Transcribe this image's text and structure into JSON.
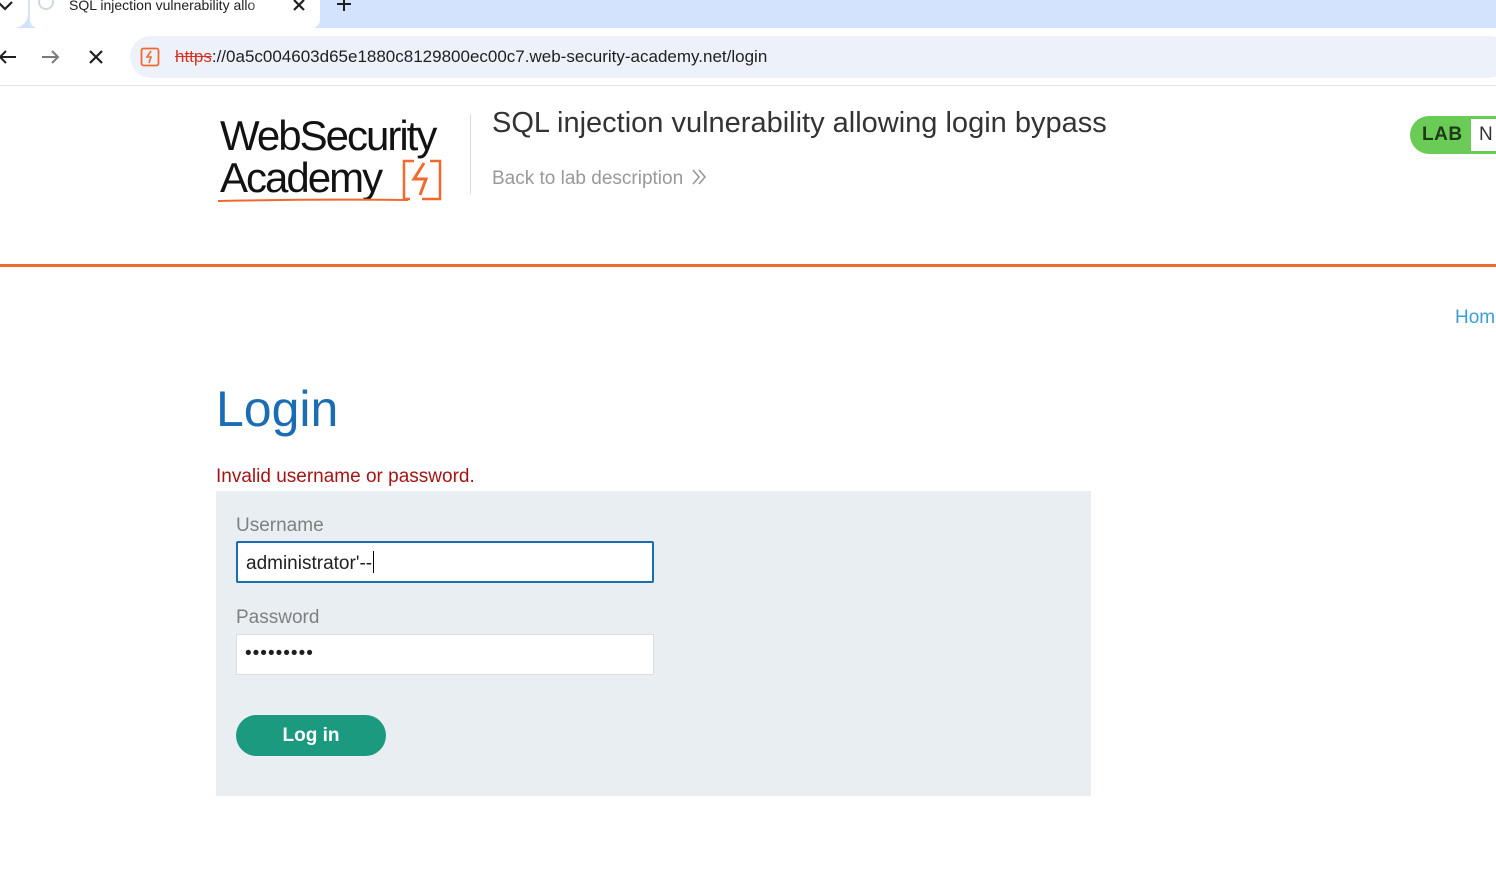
{
  "browser": {
    "tab_title": "SQL injection vulnerability allo",
    "url_scheme": "https",
    "url_rest": "://0a5c004603d65e1880c8129800ec00c7.web-security-academy.net/login"
  },
  "header": {
    "logo_line1": "WebSecurity",
    "logo_line2": "Academy",
    "lab_title": "SQL injection vulnerability allowing login bypass",
    "back_link": "Back to lab description",
    "badge_label": "LAB",
    "badge_status": "N"
  },
  "nav": {
    "home": "Hom"
  },
  "main": {
    "heading": "Login",
    "error": "Invalid username or password.",
    "username_label": "Username",
    "username_value": "administrator'--",
    "password_label": "Password",
    "password_value": "•••••••••",
    "submit_label": "Log in"
  },
  "colors": {
    "accent_orange": "#f06a2f",
    "heading_blue": "#1a6db3",
    "error_red": "#a51414",
    "button_green": "#1c9a80",
    "badge_green": "#6acb57"
  },
  "icons": [
    "chevron-down-icon",
    "close-icon",
    "plus-icon",
    "back-arrow-icon",
    "forward-arrow-icon",
    "stop-icon",
    "site-favicon-icon",
    "double-chevron-right-icon"
  ]
}
